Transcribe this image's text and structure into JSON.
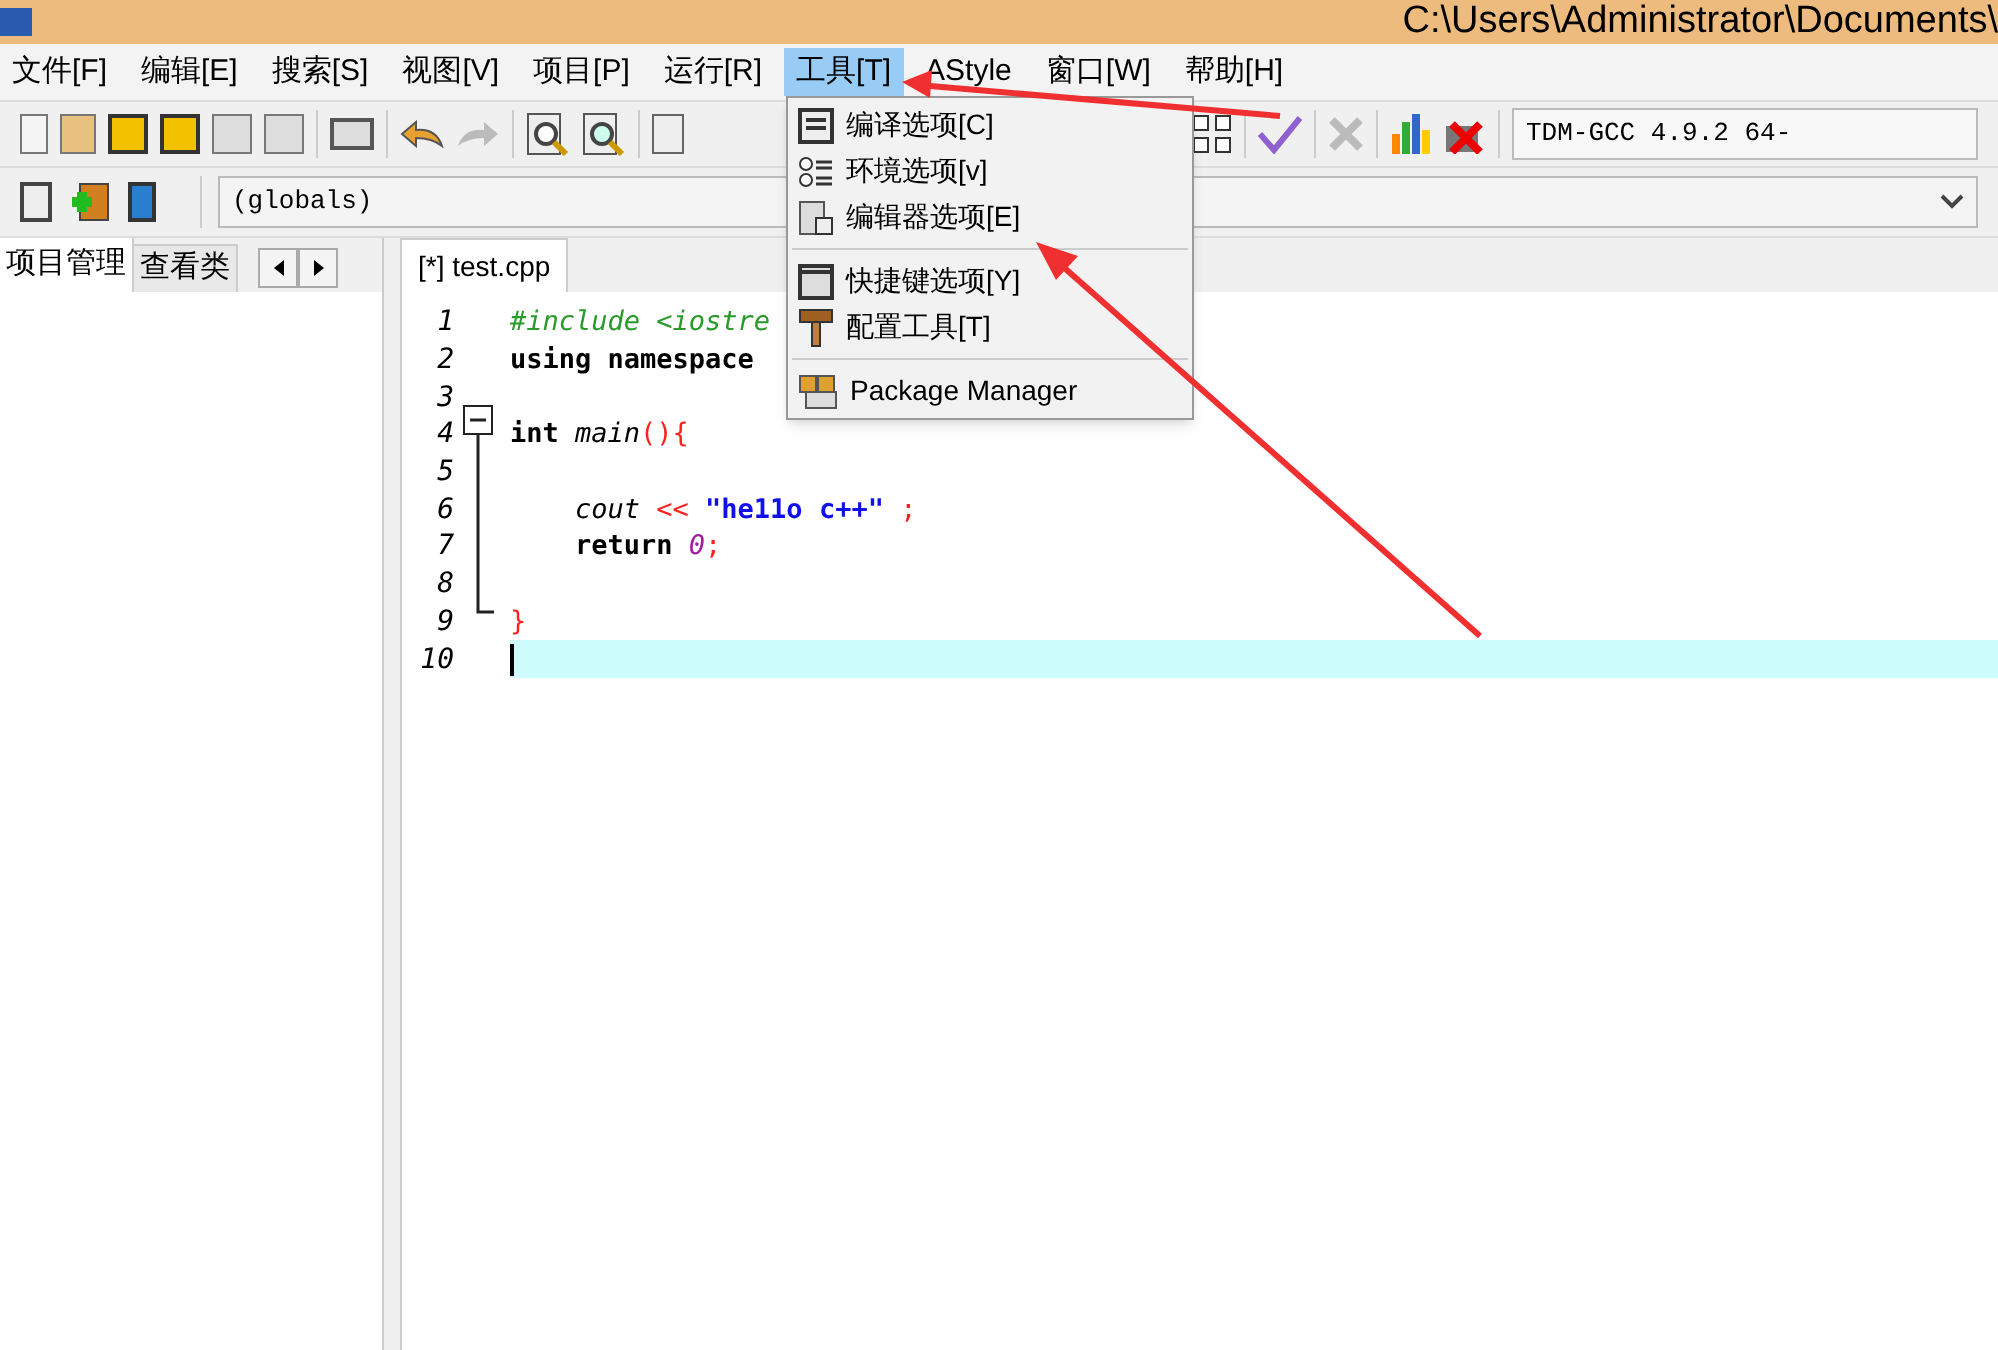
{
  "window": {
    "title": "C:\\Users\\Administrator\\Documents\\"
  },
  "menu_bar": [
    {
      "label": "文件[F]",
      "selected": false
    },
    {
      "label": "编辑[E]",
      "selected": false
    },
    {
      "label": "搜索[S]",
      "selected": false
    },
    {
      "label": "视图[V]",
      "selected": false
    },
    {
      "label": "项目[P]",
      "selected": false
    },
    {
      "label": "运行[R]",
      "selected": false
    },
    {
      "label": "工具[T]",
      "selected": true
    },
    {
      "label": "AStyle",
      "selected": false
    },
    {
      "label": "窗口[W]",
      "selected": false
    },
    {
      "label": "帮助[H]",
      "selected": false
    }
  ],
  "compiler_select": {
    "value": "TDM-GCC 4.9.2 64-"
  },
  "scope_select": {
    "value": "(globals)"
  },
  "side_tabs": [
    {
      "label": "项目管理",
      "selected": true
    },
    {
      "label": "查看类",
      "selected": false
    }
  ],
  "editor_tabs": [
    {
      "label": "[*] test.cpp",
      "selected": true
    }
  ],
  "tools_menu": [
    {
      "kind": "item",
      "label": "编译选项[C]"
    },
    {
      "kind": "item",
      "label": "环境选项[v]"
    },
    {
      "kind": "item",
      "label": "编辑器选项[E]"
    },
    {
      "kind": "separator"
    },
    {
      "kind": "item",
      "label": "快捷键选项[Y]"
    },
    {
      "kind": "item",
      "label": "配置工具[T]"
    },
    {
      "kind": "separator"
    },
    {
      "kind": "item",
      "label": "Package Manager"
    }
  ],
  "code_lines": [
    {
      "number": "1",
      "current": false,
      "tokens": [
        {
          "kind": "preprocessor",
          "text": "#include <iostre"
        }
      ]
    },
    {
      "number": "2",
      "current": false,
      "tokens": [
        {
          "kind": "keyword",
          "text": "using namespace"
        }
      ]
    },
    {
      "number": "3",
      "current": false
    },
    {
      "number": "4",
      "current": false,
      "tokens": [
        {
          "kind": "keyword",
          "text": "int "
        },
        {
          "kind": "identifier",
          "text": "main"
        },
        {
          "kind": "symbol",
          "text": "(){"
        }
      ]
    },
    {
      "number": "5",
      "current": false
    },
    {
      "number": "6",
      "current": false,
      "tokens": [
        {
          "kind": "identifier",
          "text": "    cout "
        },
        {
          "kind": "symbol",
          "text": "<< "
        },
        {
          "kind": "string",
          "text": "\"he11o c++\" "
        },
        {
          "kind": "symbol",
          "text": ";"
        }
      ]
    },
    {
      "number": "7",
      "current": false,
      "tokens": [
        {
          "kind": "keyword",
          "text": "    return "
        },
        {
          "kind": "number",
          "text": "0"
        },
        {
          "kind": "symbol",
          "text": ";"
        }
      ]
    },
    {
      "number": "8",
      "current": false
    },
    {
      "number": "9",
      "current": false,
      "tokens": [
        {
          "kind": "symbol",
          "text": "}"
        }
      ]
    },
    {
      "number": "10",
      "current": true
    }
  ]
}
